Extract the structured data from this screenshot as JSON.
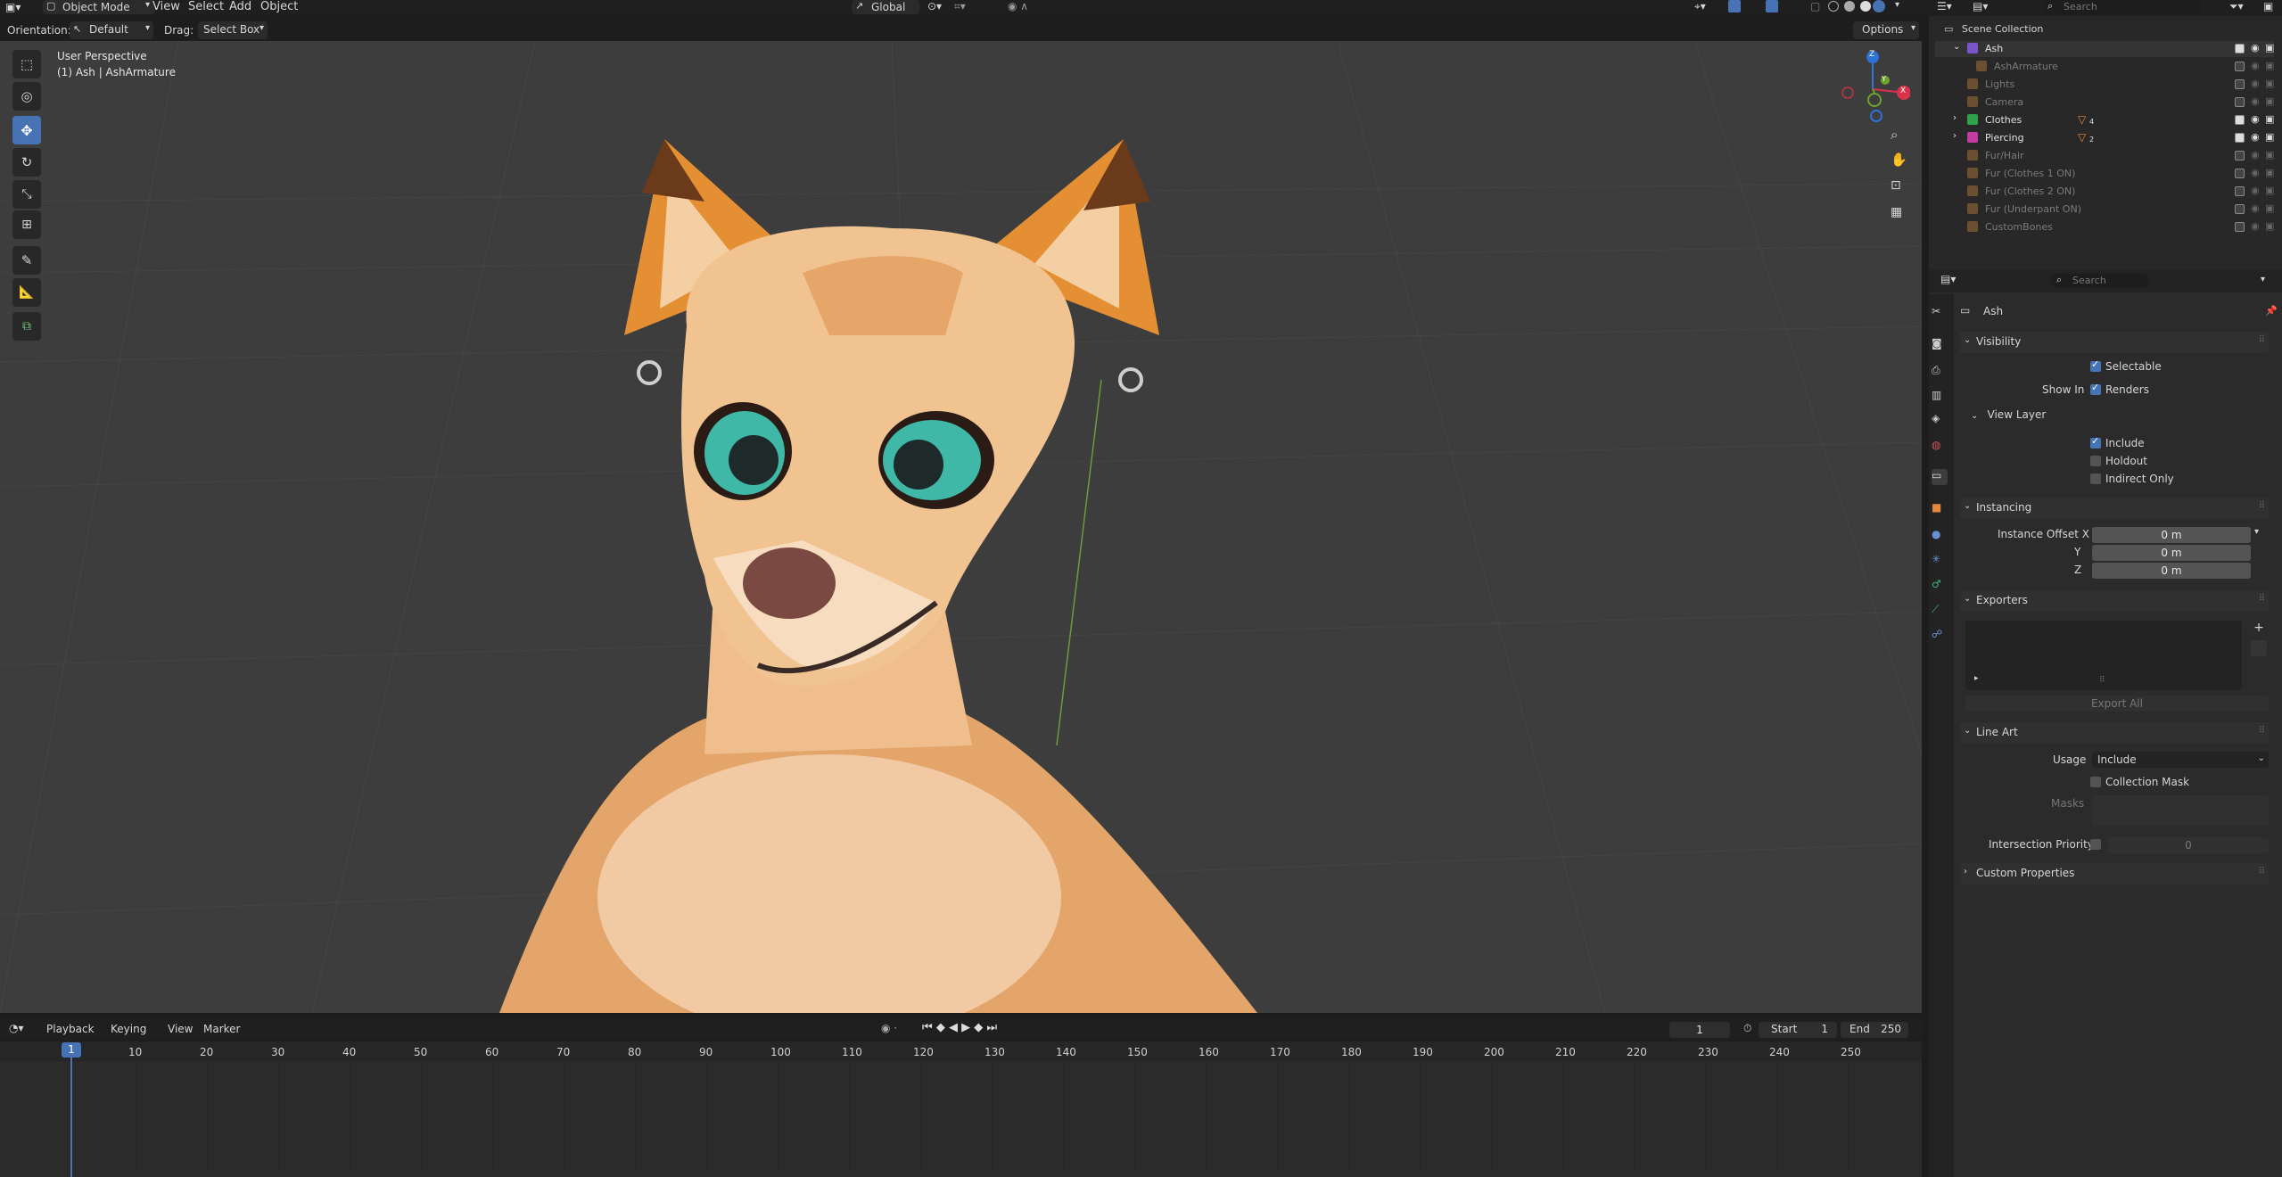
{
  "topbar": {
    "mode": "Object Mode",
    "menus": [
      "View",
      "Select",
      "Add",
      "Object"
    ],
    "transform": "Global",
    "search_placeholder": "Search"
  },
  "header2": {
    "orientation_label": "Orientation:",
    "orientation_value": "Default",
    "drag_label": "Drag:",
    "drag_value": "Select Box",
    "options": "Options"
  },
  "viewport": {
    "perspective": "User Perspective",
    "object": "(1) Ash | AshArmature",
    "gizmo": {
      "x": "X",
      "y": "Y",
      "z": "Z"
    }
  },
  "outliner": {
    "root": "Scene Collection",
    "items": [
      {
        "label": "Ash",
        "dim": false
      },
      {
        "label": "AshArmature",
        "dim": true
      },
      {
        "label": "Lights",
        "dim": true
      },
      {
        "label": "Camera",
        "dim": true
      },
      {
        "label": "Clothes",
        "dim": false,
        "badge": "4"
      },
      {
        "label": "Piercing",
        "dim": false,
        "badge": "2"
      },
      {
        "label": "Fur/Hair",
        "dim": true
      },
      {
        "label": "Fur (Clothes 1 ON)",
        "dim": true
      },
      {
        "label": "Fur (Clothes 2 ON)",
        "dim": true
      },
      {
        "label": "Fur (Underpant ON)",
        "dim": true
      },
      {
        "label": "CustomBones",
        "dim": true
      }
    ]
  },
  "properties": {
    "search_placeholder": "Search",
    "object_name": "Ash",
    "visibility": {
      "title": "Visibility",
      "selectable": "Selectable",
      "show_in": "Show In",
      "renders": "Renders",
      "view_layer": "View Layer",
      "include": "Include",
      "holdout": "Holdout",
      "indirect_only": "Indirect Only"
    },
    "instancing": {
      "title": "Instancing",
      "offset_x_label": "Instance Offset X",
      "y_label": "Y",
      "z_label": "Z",
      "x": "0 m",
      "y": "0 m",
      "z": "0 m"
    },
    "exporters": {
      "title": "Exporters",
      "export_all": "Export All"
    },
    "line_art": {
      "title": "Line Art",
      "usage_label": "Usage",
      "usage_value": "Include",
      "collection_mask": "Collection Mask",
      "masks": "Masks",
      "intersection_priority": "Intersection Priority",
      "priority_value": "0"
    },
    "custom_properties": "Custom Properties"
  },
  "timeline": {
    "menus": [
      "Playback",
      "Keying",
      "View",
      "Marker"
    ],
    "current_frame": "1",
    "start_label": "Start",
    "start": "1",
    "end_label": "End",
    "end": "250",
    "playhead": "1",
    "ticks": [
      "10",
      "20",
      "30",
      "40",
      "50",
      "60",
      "70",
      "80",
      "90",
      "100",
      "110",
      "120",
      "130",
      "140",
      "150",
      "160",
      "170",
      "180",
      "190",
      "200",
      "210",
      "220",
      "230",
      "240",
      "250"
    ]
  },
  "colors": {
    "accent": "#4772b3",
    "viewport_bg": "#3d3d3d",
    "panel_bg": "#2b2b2b",
    "fur_orange": "#e0913e",
    "fur_cream": "#f0c79a",
    "eye_teal": "#3fb8a8"
  }
}
